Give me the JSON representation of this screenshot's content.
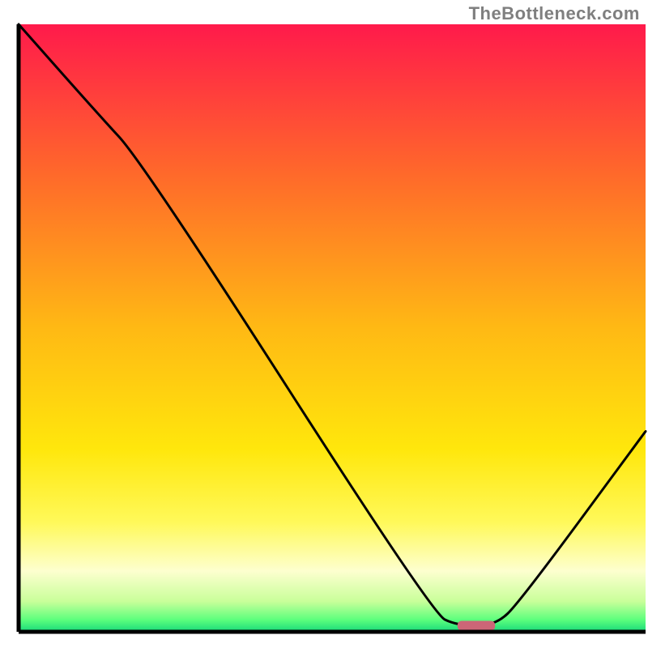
{
  "attribution": "TheBottleneck.com",
  "chart_data": {
    "type": "line",
    "title": "",
    "xlabel": "",
    "ylabel": "",
    "x_range": [
      0,
      100
    ],
    "y_range": [
      0,
      100
    ],
    "series": [
      {
        "name": "bottleneck-curve",
        "x": [
          0,
          12,
          20,
          66,
          70,
          76,
          80,
          100
        ],
        "y": [
          100,
          86,
          77,
          3,
          1,
          1,
          5,
          33
        ]
      }
    ],
    "marker": {
      "name": "marker-bar",
      "x_start": 70,
      "x_end": 76,
      "y": 1,
      "color": "#cc6677"
    },
    "background_gradient": {
      "stops": [
        {
          "offset": 0,
          "color": "#ff1a4b"
        },
        {
          "offset": 25,
          "color": "#ff6a2a"
        },
        {
          "offset": 50,
          "color": "#ffb914"
        },
        {
          "offset": 70,
          "color": "#ffe70c"
        },
        {
          "offset": 82,
          "color": "#fff95a"
        },
        {
          "offset": 90,
          "color": "#fdffcf"
        },
        {
          "offset": 95,
          "color": "#c9ff9a"
        },
        {
          "offset": 98,
          "color": "#5dff7d"
        },
        {
          "offset": 100,
          "color": "#17d87a"
        }
      ]
    },
    "grid": false,
    "legend": false
  }
}
